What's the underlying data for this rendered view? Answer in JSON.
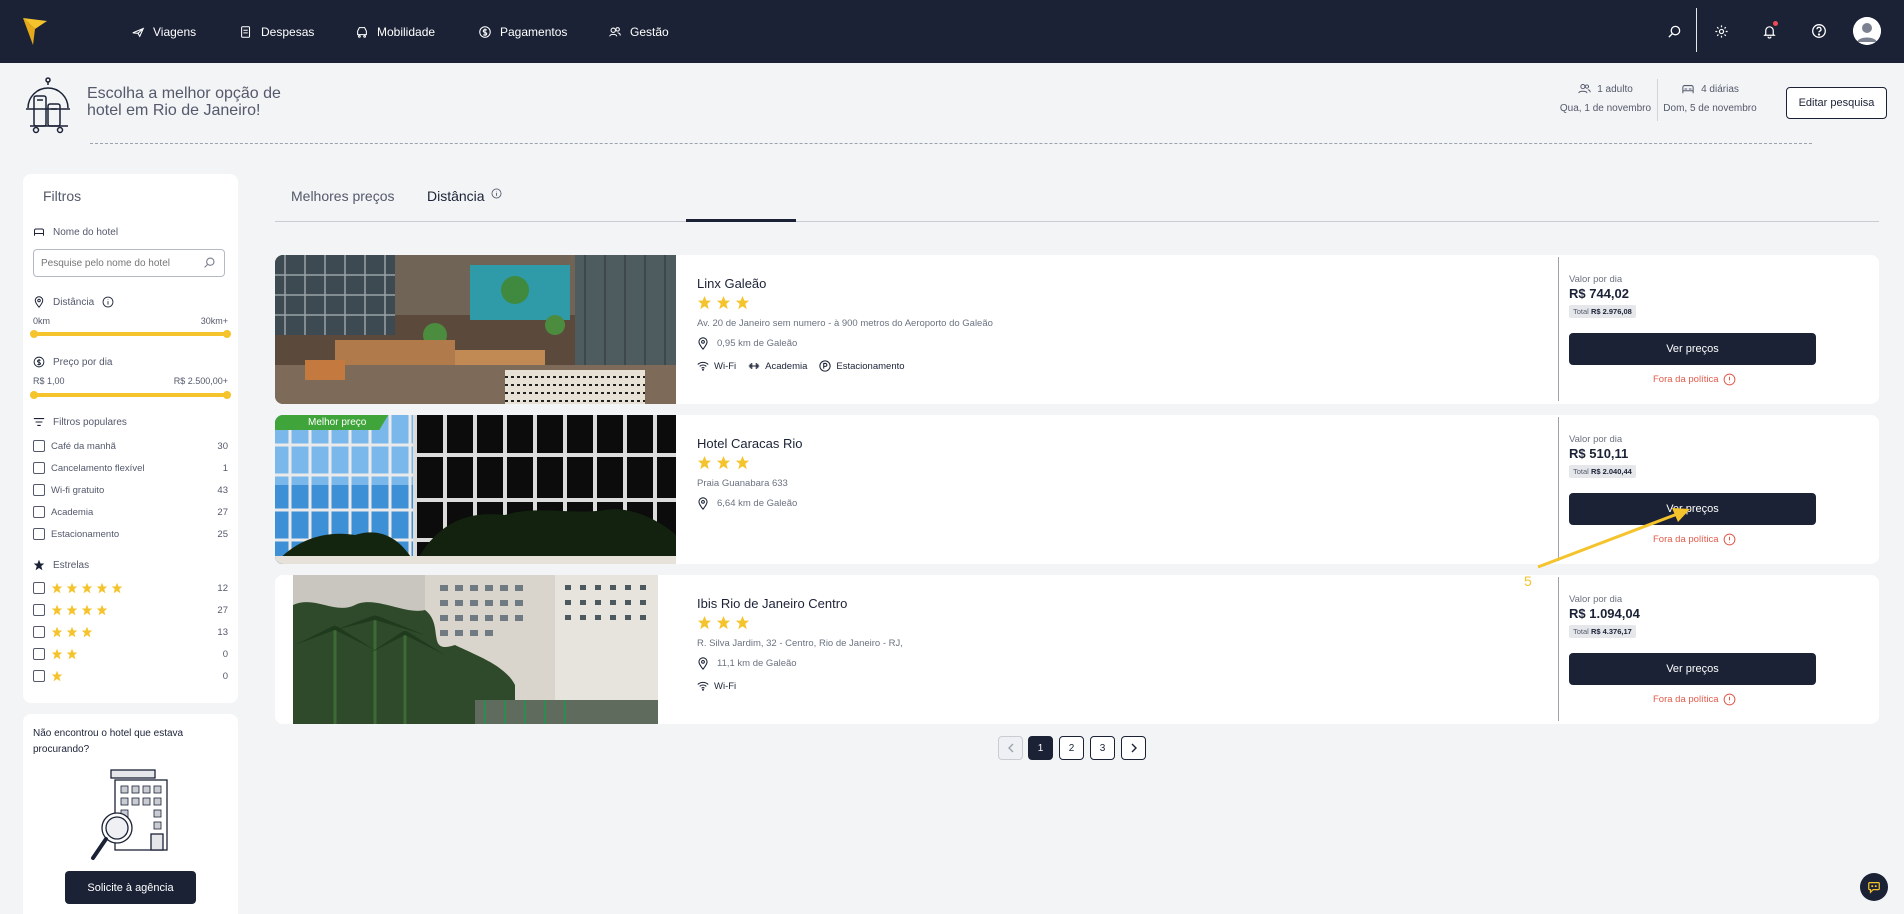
{
  "nav": {
    "items": [
      {
        "label": "Viagens",
        "icon": "plane-icon"
      },
      {
        "label": "Despesas",
        "icon": "receipt-icon"
      },
      {
        "label": "Mobilidade",
        "icon": "car-icon"
      },
      {
        "label": "Pagamentos",
        "icon": "dollar-circle-icon"
      },
      {
        "label": "Gestão",
        "icon": "users-icon"
      }
    ],
    "right_icons": [
      "search-icon",
      "gear-icon",
      "bell-icon",
      "help-icon",
      "avatar"
    ]
  },
  "header": {
    "title": "Escolha a melhor opção de hotel em Rio de Janeiro!",
    "guests": "1 adulto",
    "checkin": "Qua, 1 de novembro",
    "nights": "4 diárias",
    "checkout": "Dom, 5 de novembro",
    "edit_label": "Editar pesquisa"
  },
  "filters": {
    "title": "Filtros",
    "hotel_name_label": "Nome do hotel",
    "hotel_name_placeholder": "Pesquise pelo nome do hotel",
    "distance_label": "Distância",
    "distance_min": "0km",
    "distance_max": "30km+",
    "price_label": "Preço por dia",
    "price_min": "R$ 1,00",
    "price_max": "R$ 2.500,00+",
    "popular_label": "Filtros populares",
    "popular": [
      {
        "label": "Café da manhã",
        "count": "30"
      },
      {
        "label": "Cancelamento flexível",
        "count": "1"
      },
      {
        "label": "Wi-fi gratuito",
        "count": "43"
      },
      {
        "label": "Academia",
        "count": "27"
      },
      {
        "label": "Estacionamento",
        "count": "25"
      }
    ],
    "stars_label": "Estrelas",
    "stars": [
      {
        "stars": 5,
        "count": "12"
      },
      {
        "stars": 4,
        "count": "27"
      },
      {
        "stars": 3,
        "count": "13"
      },
      {
        "stars": 2,
        "count": "0"
      },
      {
        "stars": 1,
        "count": "0"
      }
    ]
  },
  "agency": {
    "text": "Não encontrou o hotel que estava procurando?",
    "button": "Solicite à agência"
  },
  "tabs": [
    {
      "label": "Melhores preços",
      "active": false
    },
    {
      "label": "Distância",
      "active": true
    }
  ],
  "hotels": [
    {
      "name": "Linx Galeão",
      "stars": 3,
      "address": "Av. 20 de Janeiro sem numero - à 900 metros do Aeroporto do Galeão",
      "distance": "0,95 km de Galeão",
      "amenities": [
        {
          "label": "Wi-Fi",
          "icon": "wifi-icon"
        },
        {
          "label": "Academia",
          "icon": "dumbbell-icon"
        },
        {
          "label": "Estacionamento",
          "icon": "parking-icon"
        }
      ],
      "price_label": "Valor por dia",
      "price": "R$ 744,02",
      "total_label": "Total",
      "total": "R$ 2.976,08",
      "button": "Ver preços",
      "policy": "Fora da política",
      "badge": ""
    },
    {
      "name": "Hotel Caracas Rio",
      "stars": 3,
      "address": "Praia Guanabara 633",
      "distance": "6,64 km de Galeão",
      "amenities": [],
      "price_label": "Valor por dia",
      "price": "R$ 510,11",
      "total_label": "Total",
      "total": "R$ 2.040,44",
      "button": "Ver preços",
      "policy": "Fora da política",
      "badge": "Melhor preço"
    },
    {
      "name": "Ibis Rio de Janeiro Centro",
      "stars": 3,
      "address": "R. Silva Jardim, 32 - Centro, Rio de Janeiro - RJ,",
      "distance": "11,1 km de Galeão",
      "amenities": [
        {
          "label": "Wi-Fi",
          "icon": "wifi-icon"
        }
      ],
      "price_label": "Valor por dia",
      "price": "R$ 1.094,04",
      "total_label": "Total",
      "total": "R$ 4.376,17",
      "button": "Ver preços",
      "policy": "Fora da política",
      "badge": ""
    }
  ],
  "pagination": {
    "pages": [
      "1",
      "2",
      "3"
    ],
    "current": "1"
  },
  "annotation": {
    "label": "5",
    "color": "#f5c32b"
  },
  "colors": {
    "navy": "#1b2236",
    "accent": "#f5c32b",
    "badge_green": "#3fa53a",
    "policy_red": "#e05a4a"
  }
}
